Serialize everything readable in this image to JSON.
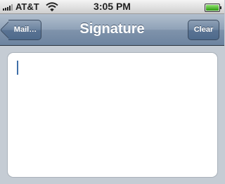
{
  "status_bar": {
    "carrier": "AT&T",
    "time": "3:05 PM",
    "signal_bars": 5,
    "signal_bars_active": 4,
    "wifi_icon": "wifi-icon",
    "battery_level": 1.0
  },
  "nav_bar": {
    "back_label": "Mail…",
    "title": "Signature",
    "clear_label": "Clear"
  },
  "signature": {
    "value": ""
  },
  "colors": {
    "nav_bar": "#6d84a0",
    "background": "#c5ccd4",
    "cursor": "#3f6fa8"
  }
}
